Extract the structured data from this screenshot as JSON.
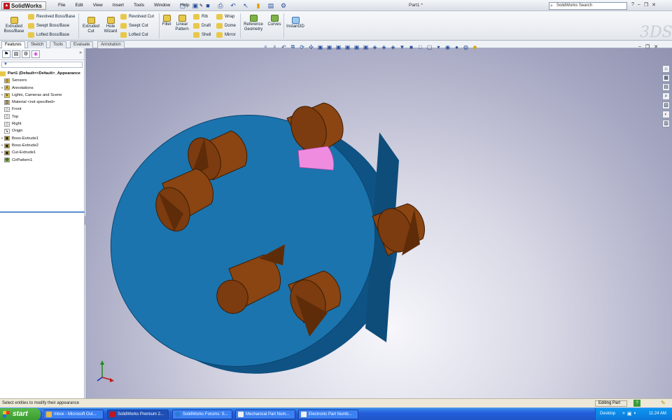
{
  "app": {
    "logo_text": "SolidWorks",
    "menu": [
      "File",
      "Edit",
      "View",
      "Insert",
      "Tools",
      "Window",
      "Help"
    ],
    "document_title": "Part1 *",
    "search_placeholder": "SolidWorks Search"
  },
  "command_manager": {
    "extruded_boss": "Extruded\nBoss/Base",
    "revolved_boss": "Revolved Boss/Base",
    "swept_boss": "Swept Boss/Base",
    "lofted_boss": "Lofted Boss/Base",
    "extruded_cut": "Extruded\nCut",
    "hole_wizard": "Hole\nWizard",
    "revolved_cut": "Revolved Cut",
    "swept_cut": "Swept Cut",
    "lofted_cut": "Lofted Cut",
    "fillet": "Fillet",
    "linear_pattern": "Linear\nPattern",
    "rib": "Rib",
    "draft": "Draft",
    "shell": "Shell",
    "wrap": "Wrap",
    "dome": "Dome",
    "mirror": "Mirror",
    "reference_geometry": "Reference\nGeometry",
    "curves": "Curves",
    "instant3d": "Instant3D"
  },
  "tabs": [
    "Features",
    "Sketch",
    "Tools",
    "Evaluate",
    "Annotation"
  ],
  "active_tab": "Features",
  "feature_tree": {
    "root": "Part1  (Default<<Default>_Appearance",
    "items": [
      {
        "label": "Sensors",
        "icon": "sensor-icon",
        "expandable": false
      },
      {
        "label": "Annotations",
        "icon": "annotation-icon",
        "expandable": true
      },
      {
        "label": "Lights, Cameras and Scene",
        "icon": "lights-icon",
        "expandable": true
      },
      {
        "label": "Material <not specified>",
        "icon": "material-icon",
        "expandable": false
      },
      {
        "label": "Front",
        "icon": "plane-icon",
        "expandable": false
      },
      {
        "label": "Top",
        "icon": "plane-icon",
        "expandable": false
      },
      {
        "label": "Right",
        "icon": "plane-icon",
        "expandable": false
      },
      {
        "label": "Origin",
        "icon": "origin-icon",
        "expandable": false
      },
      {
        "label": "Boss-Extrude1",
        "icon": "extrude-icon",
        "expandable": true
      },
      {
        "label": "Boss-Extrude2",
        "icon": "extrude-icon",
        "expandable": true
      },
      {
        "label": "Cut-Extrude1",
        "icon": "cut-icon",
        "expandable": true
      },
      {
        "label": "CirPattern1",
        "icon": "circular-pattern-icon",
        "expandable": false
      }
    ]
  },
  "status": {
    "message": "Select entities to modify their appearance",
    "mode": "Editing Part"
  },
  "taskbar": {
    "start": "start",
    "tasks": [
      {
        "label": "Inbox - Microsoft Out...",
        "active": false,
        "color": "#e8b84a"
      },
      {
        "label": "SolidWorks Premium 2...",
        "active": true,
        "color": "#c0161d"
      },
      {
        "label": "SolidWorks Forums: S...",
        "active": false,
        "color": "#2e7bd6"
      },
      {
        "label": "Mechanical Part Num...",
        "active": false,
        "color": "#f0f0f0"
      },
      {
        "label": "Electronic Part Numb...",
        "active": false,
        "color": "#f0f0f0"
      }
    ],
    "desktop_label": "Desktop",
    "clock": "11:24 AM"
  },
  "colors": {
    "disc": "#1a6fa6",
    "disc_rim": "#0e4f7e",
    "pins": "#8a4512",
    "pin_dark": "#5e2c08",
    "selected_face": "#f08ce0"
  }
}
